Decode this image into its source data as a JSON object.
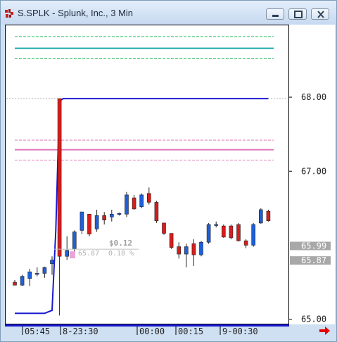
{
  "window": {
    "title": "S.SPLK - Splunk, Inc., 3 Min",
    "buttons": [
      "minimize",
      "restore",
      "close"
    ]
  },
  "chart_data": {
    "type": "candlestick",
    "symbol": "S.SPLK",
    "interval": "3 Min",
    "ylim": [
      64.93,
      68.98
    ],
    "y_ticks": [
      "68.00",
      "67.00",
      "65.00"
    ],
    "x_ticks": [
      "05:45",
      "8-23:30",
      "00:00",
      "00:15",
      "9-00:30"
    ],
    "price_labels": [
      {
        "text": "65.99",
        "value": 65.99
      },
      {
        "text": "65.87",
        "value": 65.87
      }
    ],
    "annotation": {
      "change": "$0.12",
      "price": "65.87",
      "percent": "0.18 %"
    },
    "candles": [
      {
        "o": 65.5,
        "h": 65.53,
        "l": 65.46,
        "c": 65.46
      },
      {
        "o": 65.46,
        "h": 65.6,
        "l": 65.45,
        "c": 65.58
      },
      {
        "o": 65.55,
        "h": 65.68,
        "l": 65.45,
        "c": 65.64
      },
      {
        "o": 65.62,
        "h": 65.7,
        "l": 65.58,
        "c": 65.62
      },
      {
        "o": 65.62,
        "h": 65.71,
        "l": 65.56,
        "c": 65.7
      },
      {
        "o": 65.75,
        "h": 65.85,
        "l": 65.6,
        "c": 65.8
      },
      {
        "o": 67.98,
        "h": 67.98,
        "l": 65.05,
        "c": 65.85
      },
      {
        "o": 65.85,
        "h": 66.12,
        "l": 65.8,
        "c": 65.93
      },
      {
        "o": 65.95,
        "h": 66.2,
        "l": 65.88,
        "c": 66.18
      },
      {
        "o": 66.2,
        "h": 66.45,
        "l": 66.15,
        "c": 66.45
      },
      {
        "o": 66.42,
        "h": 66.42,
        "l": 66.12,
        "c": 66.15
      },
      {
        "o": 66.22,
        "h": 66.48,
        "l": 66.18,
        "c": 66.4
      },
      {
        "o": 66.4,
        "h": 66.45,
        "l": 66.28,
        "c": 66.34
      },
      {
        "o": 66.38,
        "h": 66.48,
        "l": 66.32,
        "c": 66.42
      },
      {
        "o": 66.42,
        "h": 66.44,
        "l": 66.4,
        "c": 66.43
      },
      {
        "o": 66.42,
        "h": 66.72,
        "l": 66.38,
        "c": 66.68
      },
      {
        "o": 66.64,
        "h": 66.68,
        "l": 66.48,
        "c": 66.49
      },
      {
        "o": 66.52,
        "h": 66.7,
        "l": 66.5,
        "c": 66.68
      },
      {
        "o": 66.7,
        "h": 66.78,
        "l": 66.55,
        "c": 66.58
      },
      {
        "o": 66.58,
        "h": 66.6,
        "l": 66.3,
        "c": 66.33
      },
      {
        "o": 66.3,
        "h": 66.3,
        "l": 66.14,
        "c": 66.16
      },
      {
        "o": 66.16,
        "h": 66.16,
        "l": 65.95,
        "c": 65.97
      },
      {
        "o": 65.98,
        "h": 66.04,
        "l": 65.82,
        "c": 65.88
      },
      {
        "o": 65.88,
        "h": 66.02,
        "l": 65.7,
        "c": 65.98
      },
      {
        "o": 66.02,
        "h": 66.08,
        "l": 65.72,
        "c": 65.87
      },
      {
        "o": 65.87,
        "h": 66.06,
        "l": 65.85,
        "c": 66.04
      },
      {
        "o": 66.04,
        "h": 66.3,
        "l": 66.02,
        "c": 66.28
      },
      {
        "o": 66.28,
        "h": 66.32,
        "l": 66.24,
        "c": 66.28
      },
      {
        "o": 66.26,
        "h": 66.28,
        "l": 66.1,
        "c": 66.11
      },
      {
        "o": 66.26,
        "h": 66.28,
        "l": 66.08,
        "c": 66.1
      },
      {
        "o": 66.28,
        "h": 66.3,
        "l": 66.05,
        "c": 66.06
      },
      {
        "o": 66.06,
        "h": 66.08,
        "l": 65.96,
        "c": 66.0
      },
      {
        "o": 66.0,
        "h": 66.3,
        "l": 65.98,
        "c": 66.28
      },
      {
        "o": 66.3,
        "h": 66.5,
        "l": 66.29,
        "c": 66.48
      },
      {
        "o": 66.46,
        "h": 66.48,
        "l": 66.32,
        "c": 66.33
      }
    ],
    "blue_line": [
      {
        "i": 0,
        "v": 65.08
      },
      {
        "i": 4,
        "v": 65.08
      },
      {
        "i": 5,
        "v": 65.12
      },
      {
        "i": 5.5,
        "v": 66.2
      },
      {
        "i": 6,
        "v": 67.95
      },
      {
        "i": 6.5,
        "v": 67.98
      },
      {
        "i": 34,
        "v": 67.98
      }
    ],
    "horizontal_lines": [
      {
        "value": 68.82,
        "color": "#2bbf60",
        "style": "dashed"
      },
      {
        "value": 68.66,
        "color": "#19a7a7",
        "style": "solid"
      },
      {
        "value": 68.52,
        "color": "#2bbf60",
        "style": "dashed"
      },
      {
        "value": 67.98,
        "color": "#b0b0b0",
        "style": "dotted"
      },
      {
        "value": 67.42,
        "color": "#e07ab8",
        "style": "dashed"
      },
      {
        "value": 67.29,
        "color": "#e07ab8",
        "style": "solid"
      },
      {
        "value": 67.15,
        "color": "#e07ab8",
        "style": "dashed"
      }
    ],
    "colors": {
      "up": "#1f5fd8",
      "down": "#d81c1c",
      "label_bg": "#a8a8a8",
      "arrow": "#e60000"
    }
  }
}
